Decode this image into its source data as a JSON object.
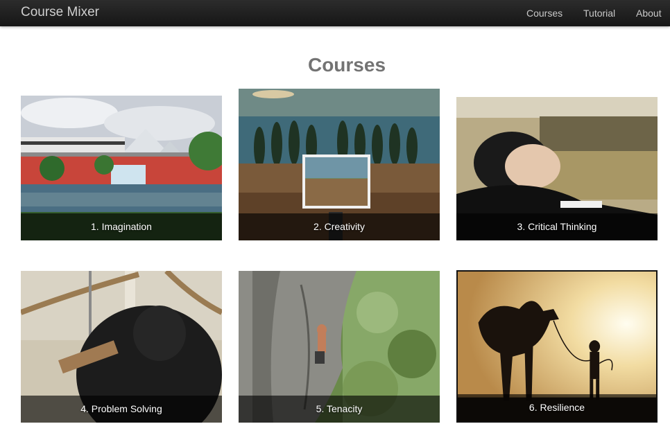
{
  "navbar": {
    "brand": "Course Mixer",
    "links": [
      "Courses",
      "Tutorial",
      "About"
    ]
  },
  "page": {
    "title": "Courses"
  },
  "courses": [
    {
      "label": "1. Imagination",
      "image": "monorail-pyramid-photo"
    },
    {
      "label": "2. Creativity",
      "image": "painting-in-field-photo"
    },
    {
      "label": "3. Critical Thinking",
      "image": "person-reclining-photo"
    },
    {
      "label": "4. Problem Solving",
      "image": "gorilla-with-stick-photo"
    },
    {
      "label": "5. Tenacity",
      "image": "rock-climber-photo"
    },
    {
      "label": "6. Resilience",
      "image": "camel-silhouette-photo"
    }
  ]
}
